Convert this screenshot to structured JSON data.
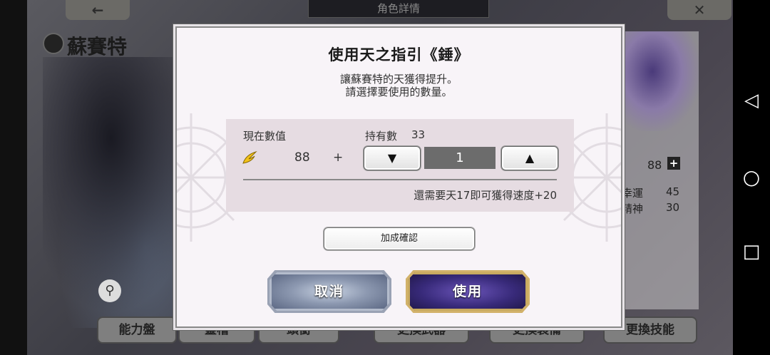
{
  "background": {
    "screen_title": "角色詳情",
    "back_label": "←",
    "close_label": "✕",
    "character_name": "蘇賽特",
    "stat_value": "88",
    "stats": [
      {
        "label": "幸運",
        "value": "45"
      },
      {
        "label": "精神",
        "value": "30"
      }
    ],
    "tabs": [
      "能力盤",
      "靈槽",
      "頭銜",
      "更換武器",
      "更換裝備",
      "更換技能"
    ]
  },
  "dialog": {
    "title": "使用天之指引《錘》",
    "desc_line1": "讓蘇賽特的天獲得提升。",
    "desc_line2": "請選擇要使用的數量。",
    "current_label": "現在數值",
    "current_value": "88",
    "plus_sign": "+",
    "owned_label": "持有數",
    "owned_count": "33",
    "decrement_label": "▼",
    "quantity": "1",
    "increment_label": "▲",
    "note": "還需要天17即可獲得速度+20",
    "confirm_label": "加成確認",
    "cancel_label": "取消",
    "use_label": "使用"
  },
  "android_nav": {
    "back_icon": "◁",
    "home_icon": "○",
    "recents_icon": "□"
  }
}
